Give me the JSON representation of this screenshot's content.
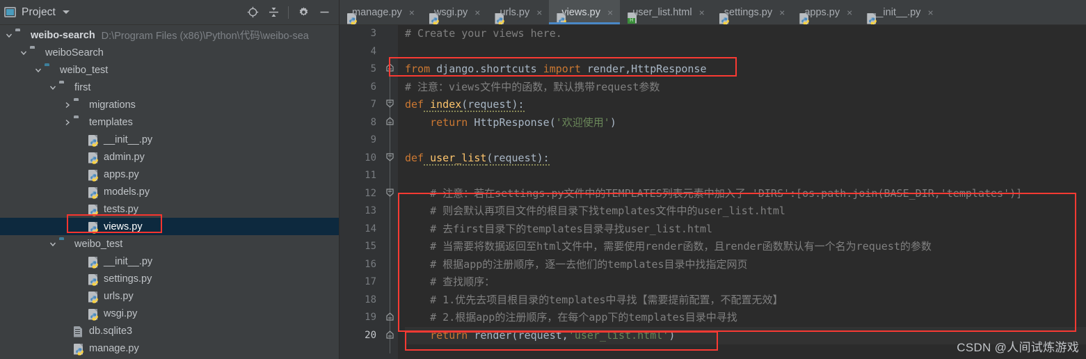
{
  "project_panel": {
    "title": "Project",
    "icon": "project-window-icon",
    "dropdown_icon": "chevron-down-icon",
    "tools": [
      {
        "name": "locate-icon",
        "label": "Select Opened File"
      },
      {
        "name": "collapse-all-icon",
        "label": "Collapse All"
      },
      {
        "name": "gear-icon",
        "label": "Settings"
      },
      {
        "name": "minimize-icon",
        "label": "Hide"
      }
    ],
    "tree": [
      {
        "label": "weibo-search",
        "hint": "D:\\Program Files (x86)\\Python\\代码\\weibo-sea",
        "icon": "folder-icon",
        "depth": 0,
        "arrow": "expanded",
        "bold": true,
        "selected": false
      },
      {
        "label": "weiboSearch",
        "hint": "",
        "icon": "folder-icon",
        "depth": 1,
        "arrow": "expanded",
        "bold": false,
        "selected": false
      },
      {
        "label": "weibo_test",
        "hint": "",
        "icon": "folder-module-icon",
        "depth": 2,
        "arrow": "expanded",
        "bold": false,
        "selected": false
      },
      {
        "label": "first",
        "hint": "",
        "icon": "folder-source-icon",
        "depth": 3,
        "arrow": "expanded",
        "bold": false,
        "selected": false
      },
      {
        "label": "migrations",
        "hint": "",
        "icon": "folder-source-icon",
        "depth": 4,
        "arrow": "collapsed",
        "bold": false,
        "selected": false
      },
      {
        "label": "templates",
        "hint": "",
        "icon": "folder-icon",
        "depth": 4,
        "arrow": "collapsed",
        "bold": false,
        "selected": false
      },
      {
        "label": "__init__.py",
        "hint": "",
        "icon": "python-file-icon",
        "depth": 5,
        "arrow": "none",
        "bold": false,
        "selected": false
      },
      {
        "label": "admin.py",
        "hint": "",
        "icon": "python-file-icon",
        "depth": 5,
        "arrow": "none",
        "bold": false,
        "selected": false
      },
      {
        "label": "apps.py",
        "hint": "",
        "icon": "python-file-icon",
        "depth": 5,
        "arrow": "none",
        "bold": false,
        "selected": false
      },
      {
        "label": "models.py",
        "hint": "",
        "icon": "python-file-icon",
        "depth": 5,
        "arrow": "none",
        "bold": false,
        "selected": false
      },
      {
        "label": "tests.py",
        "hint": "",
        "icon": "python-file-icon",
        "depth": 5,
        "arrow": "none",
        "bold": false,
        "selected": false
      },
      {
        "label": "views.py",
        "hint": "",
        "icon": "python-file-icon",
        "depth": 5,
        "arrow": "none",
        "bold": false,
        "selected": true
      },
      {
        "label": "weibo_test",
        "hint": "",
        "icon": "folder-module-icon",
        "depth": 3,
        "arrow": "expanded",
        "bold": false,
        "selected": false
      },
      {
        "label": "__init__.py",
        "hint": "",
        "icon": "python-file-icon",
        "depth": 5,
        "arrow": "none",
        "bold": false,
        "selected": false
      },
      {
        "label": "settings.py",
        "hint": "",
        "icon": "python-file-icon",
        "depth": 5,
        "arrow": "none",
        "bold": false,
        "selected": false
      },
      {
        "label": "urls.py",
        "hint": "",
        "icon": "python-file-icon",
        "depth": 5,
        "arrow": "none",
        "bold": false,
        "selected": false
      },
      {
        "label": "wsgi.py",
        "hint": "",
        "icon": "python-file-icon",
        "depth": 5,
        "arrow": "none",
        "bold": false,
        "selected": false
      },
      {
        "label": "db.sqlite3",
        "hint": "",
        "icon": "database-file-icon",
        "depth": 4,
        "arrow": "none",
        "bold": false,
        "selected": false
      },
      {
        "label": "manage.py",
        "hint": "",
        "icon": "python-file-icon",
        "depth": 4,
        "arrow": "none",
        "bold": false,
        "selected": false
      }
    ]
  },
  "tabs": [
    {
      "label": "manage.py",
      "icon": "python-file-icon",
      "active": false,
      "close": "×"
    },
    {
      "label": "wsgi.py",
      "icon": "python-file-icon",
      "active": false,
      "close": "×"
    },
    {
      "label": "urls.py",
      "icon": "python-file-icon",
      "active": false,
      "close": "×"
    },
    {
      "label": "views.py",
      "icon": "python-file-icon",
      "active": true,
      "close": "×"
    },
    {
      "label": "user_list.html",
      "icon": "html-file-icon",
      "active": false,
      "close": "×"
    },
    {
      "label": "settings.py",
      "icon": "python-file-icon",
      "active": false,
      "close": "×"
    },
    {
      "label": "apps.py",
      "icon": "python-file-icon",
      "active": false,
      "close": "×"
    },
    {
      "label": "__init__.py",
      "icon": "python-file-icon",
      "active": false,
      "close": "×"
    }
  ],
  "editor": {
    "first_line": 3,
    "current_line": 20,
    "line_numbers": [
      3,
      4,
      5,
      6,
      7,
      8,
      9,
      10,
      11,
      12,
      13,
      14,
      15,
      16,
      17,
      18,
      19,
      20
    ],
    "lines": [
      {
        "n": 3,
        "text": "# Create your views here."
      },
      {
        "n": 4,
        "text": ""
      },
      {
        "n": 5,
        "text": "from django.shortcuts import render,HttpResponse"
      },
      {
        "n": 6,
        "text": "# 注意：views文件中的函数，默认携带request参数"
      },
      {
        "n": 7,
        "text": "def index(request):"
      },
      {
        "n": 8,
        "text": "    return HttpResponse('欢迎使用')"
      },
      {
        "n": 9,
        "text": ""
      },
      {
        "n": 10,
        "text": "def user_list(request):"
      },
      {
        "n": 11,
        "text": ""
      },
      {
        "n": 12,
        "text": "    # 注意：若在settings.py文件中的TEMPLATES列表元素中加入了 'DIRS':[os.path.join(BASE_DIR,'templates')]"
      },
      {
        "n": 13,
        "text": "    # 则会默认再项目文件的根目录下找templates文件中的user_list.html"
      },
      {
        "n": 14,
        "text": "    # 去first目录下的templates目录寻找user_list.html"
      },
      {
        "n": 15,
        "text": "    # 当需要将数据返回至html文件中，需要使用render函数，且render函数默认有一个名为request的参数"
      },
      {
        "n": 16,
        "text": "    # 根据app的注册顺序，逐一去他们的templates目录中找指定网页"
      },
      {
        "n": 17,
        "text": "    # 查找顺序："
      },
      {
        "n": 18,
        "text": "    # 1.优先去项目根目录的templates中寻找【需要提前配置，不配置无效】"
      },
      {
        "n": 19,
        "text": "    # 2.根据app的注册顺序，在每个app下的templates目录中寻找"
      },
      {
        "n": 20,
        "text": "    return render(request,'user_list.html')"
      }
    ],
    "tokens": {
      "l3_comment": "# Create your views here.",
      "l5_kw_from": "from",
      "l5_module": " django.shortcuts ",
      "l5_kw_import": "import",
      "l5_names": " render,HttpResponse",
      "l6_comment": "# 注意：views文件中的函数，默认携带request参数",
      "l7_kw_def": "def",
      "l7_name": " index",
      "l7_rest": "(request):",
      "l8_kw_return": "    return",
      "l8_call": " HttpResponse(",
      "l8_str": "'欢迎使用'",
      "l8_end": ")",
      "l10_kw_def": "def",
      "l10_name": " user_list",
      "l10_rest": "(request):",
      "l20_kw_return": "    return",
      "l20_call": " render(request,",
      "l20_str": "'user_list.html'",
      "l20_end": ")"
    }
  },
  "annotations": {
    "box_import": "highlight-import-line",
    "box_comment_block": "highlight-comment-block",
    "box_return_render": "highlight-return-render",
    "box_views_py": "highlight-views-py-file",
    "color": "#fa3a33"
  },
  "watermark": "CSDN @人间试炼游戏"
}
